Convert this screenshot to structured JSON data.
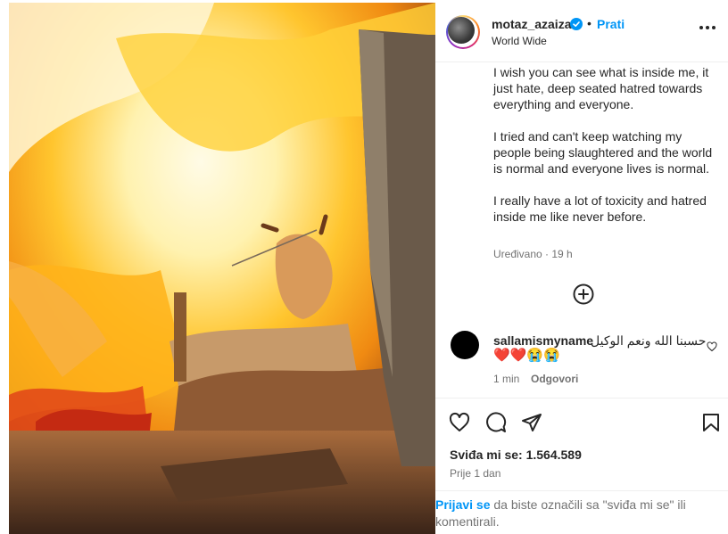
{
  "post": {
    "username": "motaz_azaiza",
    "follow_label": "Prati",
    "separator": "•",
    "location": "World Wide",
    "caption_paragraphs": [
      "I wish you can see what is inside me, it just hate, deep seated hatred towards everything and everyone.",
      "I tried and can't keep watching my people being slaughtered and the world is normal and everyone lives is normal.",
      "I really have a lot of toxicity and hatred inside me like never before."
    ],
    "edited_label": "Uređivano · 19 h"
  },
  "comment": {
    "username": "sallamismyname",
    "text": "حسبنا الله ونعم الوكيل",
    "emojis": "❤️❤️😭😭",
    "time": "1 min",
    "reply_label": "Odgovori"
  },
  "footer": {
    "likes_text": "Sviđa mi se: 1.564.589",
    "time_ago": "Prije 1 dan",
    "login_link": "Prijavi se",
    "login_rest": " da biste označili sa \"sviđa mi se\" ili komentirali."
  },
  "icons": {
    "verified": "verified-badge-icon",
    "more": "more-options-icon",
    "load_more": "plus-circle-icon",
    "like": "heart-outline-icon",
    "comment": "comment-bubble-icon",
    "share": "paper-plane-icon",
    "save": "bookmark-icon"
  },
  "colors": {
    "accent": "#0095f6",
    "text": "#262626",
    "secondary": "#737373",
    "comment_avatar": "#000000"
  }
}
